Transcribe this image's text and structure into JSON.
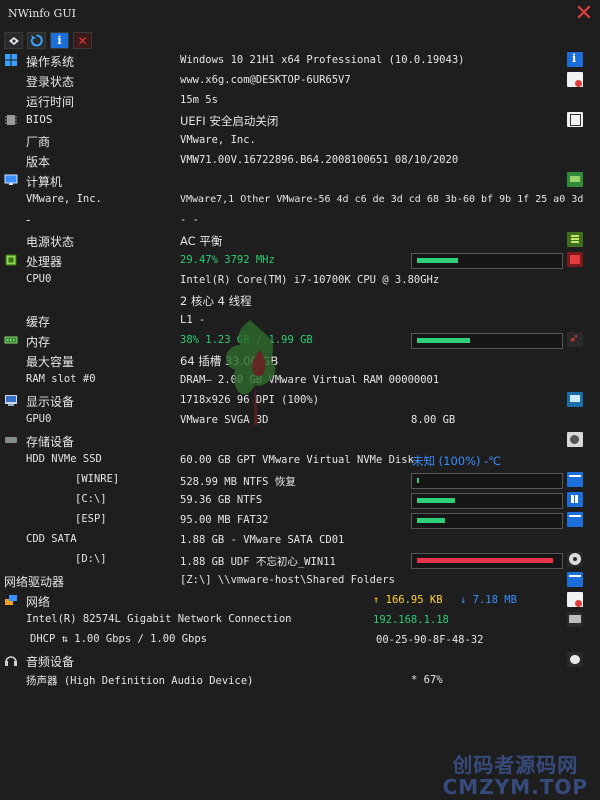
{
  "window": {
    "title": "NWinfo GUI"
  },
  "rows": {
    "os": {
      "label": "操作系统",
      "value": "Windows 10 21H1 x64 Professional (10.0.19043)"
    },
    "login": {
      "label": "登录状态",
      "value": "www.x6g.com@DESKTOP-6UR65V7"
    },
    "uptime": {
      "label": "运行时间",
      "value": "15m 5s"
    },
    "bios": {
      "label": "BIOS",
      "value": "UEFI 安全启动关闭"
    },
    "vendor": {
      "label": "厂商",
      "value": "VMware, Inc."
    },
    "version": {
      "label": "版本",
      "value": "VMW71.00V.16722896.B64.2008100651 08/10/2020"
    },
    "computer": {
      "label": "计算机",
      "value": ""
    },
    "vmware": {
      "label": "VMware, Inc.",
      "value": "VMware7,1 Other VMware-56 4d c6 de 3d cd 68 3b-60 bf 9b 1f 25 a0 3d"
    },
    "dash": {
      "label": "-",
      "value": "- -"
    },
    "power": {
      "label": "电源状态",
      "value": "AC  平衡"
    },
    "cpu": {
      "label": "处理器",
      "value": "29.47% 3792 MHz",
      "usage": 0.2947
    },
    "cpu0": {
      "label": "CPU0",
      "value": "Intel(R) Core(TM) i7-10700K CPU @ 3.80GHz"
    },
    "cores": {
      "value": "2 核心 4 线程"
    },
    "cache": {
      "label": "缓存",
      "value": "L1 -"
    },
    "memory": {
      "label": "内存",
      "value": "38% 1.23 GB / 1.99 GB",
      "usage": 0.38
    },
    "maxcap": {
      "label": "最大容量",
      "value": "64 插槽 33.00 GB"
    },
    "ramslot": {
      "label": "RAM slot #0",
      "value": "DRAM— 2.00 GB VMware Virtual RAM 00000001"
    },
    "display": {
      "label": "显示设备",
      "value": "1718x926 96 DPI (100%)"
    },
    "gpu0": {
      "label": "GPU0",
      "value": "VMware SVGA 3D",
      "value2": "8.00 GB"
    },
    "storage": {
      "label": "存储设备",
      "value": ""
    },
    "hdd": {
      "label": "HDD NVMe SSD",
      "value": "60.00 GB GPT VMware Virtual NVMe Disk",
      "status": "未知 (100%) -℃"
    },
    "winre": {
      "label": "[WINRE]",
      "value": "528.99 MB NTFS 恢复",
      "usage": 0.01
    },
    "c": {
      "label": "[C:\\]",
      "value": "59.36 GB NTFS",
      "usage": 0.27
    },
    "esp": {
      "label": "[ESP]",
      "value": "95.00 MB FAT32",
      "usage": 0.2
    },
    "cdd": {
      "label": "CDD SATA",
      "value": "1.88 GB - VMware SATA CD01"
    },
    "d": {
      "label": "[D:\\]",
      "value": "1.88 GB UDF 不忘初心_WIN11",
      "usage": 0.97
    },
    "netdrive": {
      "label": "网络驱动器",
      "value": "[Z:\\] \\\\vmware-host\\Shared Folders"
    },
    "network": {
      "label": "网络",
      "up": "↑ 166.95 KB",
      "down": "↓ 7.18 MB"
    },
    "nic": {
      "label": "Intel(R) 82574L Gigabit Network Connection",
      "value": "192.168.1.18"
    },
    "dhcp": {
      "label": "DHCP ⇅ 1.00 Gbps / 1.00 Gbps",
      "value": "00-25-90-8F-48-32"
    },
    "audio": {
      "label": "音频设备",
      "value": ""
    },
    "speaker": {
      "label": "扬声器 (High Definition Audio Device)",
      "value": "* 67%"
    }
  },
  "watermark": {
    "line1": "创码者源码网",
    "line2": "CMZYM.TOP"
  },
  "colors": {
    "accent_green": "#2ecc71",
    "bar_green": "#2ed07a",
    "bar_red": "#e8334a",
    "blue": "#3a8fff",
    "yellow": "#ffd23f"
  }
}
